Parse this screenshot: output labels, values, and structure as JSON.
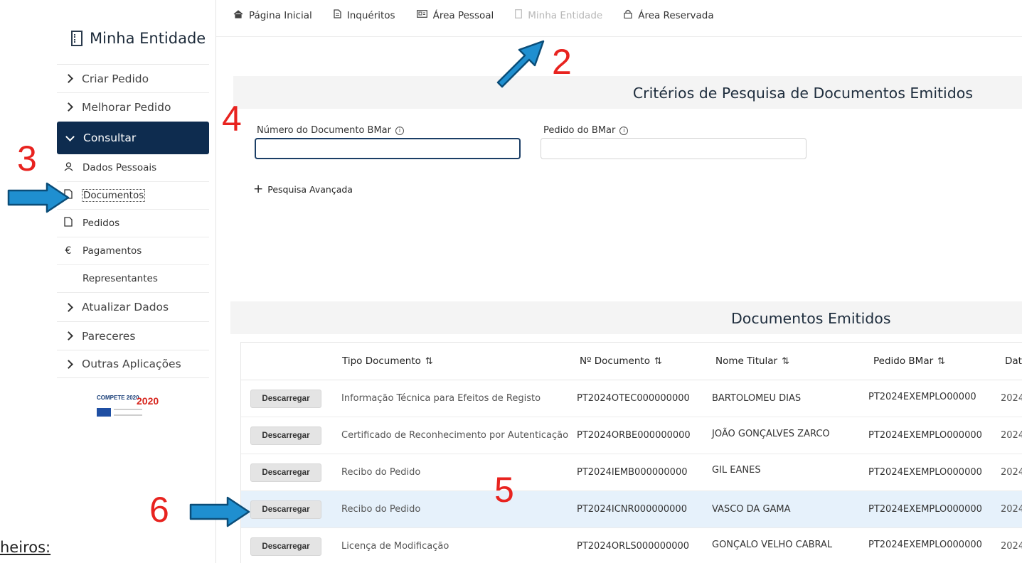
{
  "cut_text": "heiros:",
  "sidebar": {
    "title": "Minha Entidade",
    "items": [
      {
        "label": "Criar Pedido"
      },
      {
        "label": "Melhorar Pedido"
      },
      {
        "label": "Consultar"
      }
    ],
    "sub_items": [
      {
        "label": "Dados Pessoais",
        "icon": "person-icon"
      },
      {
        "label": "Documentos",
        "icon": "document-icon"
      },
      {
        "label": "Pedidos",
        "icon": "file-icon"
      },
      {
        "label": "Pagamentos",
        "icon": "euro-icon"
      },
      {
        "label": "Representantes",
        "icon": ""
      }
    ],
    "more_items": [
      {
        "label": "Atualizar Dados"
      },
      {
        "label": "Pareceres"
      },
      {
        "label": "Outras Aplicações"
      }
    ],
    "logos": {
      "compete": "COMPETE 2020",
      "portugal": "2020"
    }
  },
  "topnav": [
    {
      "label": "Página Inicial",
      "icon": "home-icon"
    },
    {
      "label": "Inquéritos",
      "icon": "document-icon"
    },
    {
      "label": "Área Pessoal",
      "icon": "id-card-icon"
    },
    {
      "label": "Minha Entidade",
      "icon": "building-icon"
    },
    {
      "label": "Área Reservada",
      "icon": "lock-icon"
    }
  ],
  "criteria": {
    "title": "Critérios de Pesquisa de Documentos Emitidos",
    "field1_label": "Número do Documento BMar",
    "field1_value": "",
    "field2_label": "Pedido do BMar",
    "field2_value": "",
    "advanced": "Pesquisa Avançada"
  },
  "results": {
    "title": "Documentos Emitidos",
    "columns": [
      "Tipo Documento",
      "Nº Documento",
      "Nome Titular",
      "Pedido BMar",
      "Dat"
    ],
    "button_label": "Descarregar",
    "rows": [
      {
        "tipo": "Informação Técnica para Efeitos de Registo",
        "numero": "PT2024OTEC000000000",
        "titular": "BARTOLOMEU DIAS",
        "pedido": "PT2024EXEMPLO00000",
        "data": "2024"
      },
      {
        "tipo": "Certificado de Reconhecimento por Autenticação",
        "numero": "PT2024ORBE000000000",
        "titular": "JOÃO GONÇALVES ZARCO",
        "pedido": "PT2024EXEMPLO000000",
        "data": "2024"
      },
      {
        "tipo": "Recibo do Pedido",
        "numero": "PT2024IEMB000000000",
        "titular": "GIL EANES",
        "pedido": "PT2024EXEMPLO000000",
        "data": "2024"
      },
      {
        "tipo": "Recibo do Pedido",
        "numero": "PT2024ICNR000000000",
        "titular": "VASCO DA GAMA",
        "pedido": "PT2024EXEMPLO000000",
        "data": "2024"
      },
      {
        "tipo": "Licença de Modificação",
        "numero": "PT2024ORLS000000000",
        "titular": "GONÇALO VELHO CABRAL",
        "pedido": "PT2024EXEMPLO000000",
        "data": "2024"
      }
    ]
  },
  "annotations": {
    "n2": "2",
    "n3": "3",
    "n4": "4",
    "n5": "5",
    "n6": "6",
    "color_numbers": "#e8231f",
    "color_arrows": "#1f8fd0"
  }
}
